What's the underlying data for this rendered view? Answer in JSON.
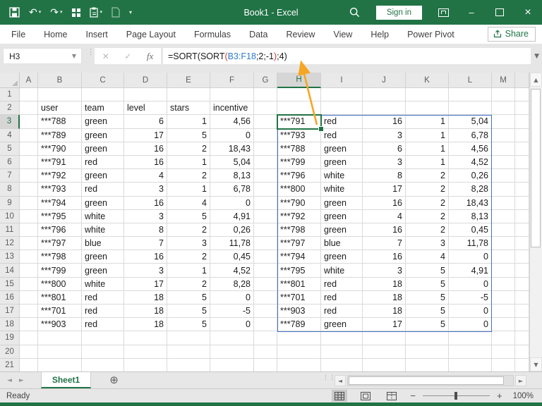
{
  "title_bar": {
    "title": "Book1 - Excel",
    "sign_in_label": "Sign in"
  },
  "ribbon": {
    "tabs": [
      "File",
      "Home",
      "Insert",
      "Page Layout",
      "Formulas",
      "Data",
      "Review",
      "View",
      "Help",
      "Power Pivot"
    ],
    "share_label": "Share"
  },
  "formula_bar": {
    "name_box_value": "H3",
    "fx_label": "fx",
    "formula_text": "=SORT(SORT(B3:F18;2;-1);4)",
    "formula_parts": [
      {
        "text": "=SORT(SORT",
        "color": "#1a1a1a"
      },
      {
        "text": "(",
        "color": "#d23430"
      },
      {
        "text": "B3:F18",
        "color": "#2e7bcf"
      },
      {
        "text": ";2;-1",
        "color": "#1a1a1a"
      },
      {
        "text": ")",
        "color": "#d23430"
      },
      {
        "text": ";4)",
        "color": "#1a1a1a"
      }
    ]
  },
  "grid": {
    "column_letters": [
      "A",
      "B",
      "C",
      "D",
      "E",
      "F",
      "G",
      "H",
      "I",
      "J",
      "K",
      "L",
      "M"
    ],
    "visible_row_count": 21,
    "selected_cell": "H3",
    "spill_range": "H3:L18",
    "source_table": {
      "start_cell": "B2",
      "headers": [
        "user",
        "team",
        "level",
        "stars",
        "incentive"
      ],
      "rows": [
        [
          "***788",
          "green",
          "6",
          "1",
          "4,56"
        ],
        [
          "***789",
          "green",
          "17",
          "5",
          "0"
        ],
        [
          "***790",
          "green",
          "16",
          "2",
          "18,43"
        ],
        [
          "***791",
          "red",
          "16",
          "1",
          "5,04"
        ],
        [
          "***792",
          "green",
          "4",
          "2",
          "8,13"
        ],
        [
          "***793",
          "red",
          "3",
          "1",
          "6,78"
        ],
        [
          "***794",
          "green",
          "16",
          "4",
          "0"
        ],
        [
          "***795",
          "white",
          "3",
          "5",
          "4,91"
        ],
        [
          "***796",
          "white",
          "8",
          "2",
          "0,26"
        ],
        [
          "***797",
          "blue",
          "7",
          "3",
          "11,78"
        ],
        [
          "***798",
          "green",
          "16",
          "2",
          "0,45"
        ],
        [
          "***799",
          "green",
          "3",
          "1",
          "4,52"
        ],
        [
          "***800",
          "white",
          "17",
          "2",
          "8,28"
        ],
        [
          "***801",
          "red",
          "18",
          "5",
          "0"
        ],
        [
          "***701",
          "red",
          "18",
          "5",
          "-5"
        ],
        [
          "***903",
          "red",
          "18",
          "5",
          "0"
        ]
      ]
    },
    "result_table": {
      "start_cell": "H3",
      "rows": [
        [
          "***791",
          "red",
          "16",
          "1",
          "5,04"
        ],
        [
          "***793",
          "red",
          "3",
          "1",
          "6,78"
        ],
        [
          "***788",
          "green",
          "6",
          "1",
          "4,56"
        ],
        [
          "***799",
          "green",
          "3",
          "1",
          "4,52"
        ],
        [
          "***796",
          "white",
          "8",
          "2",
          "0,26"
        ],
        [
          "***800",
          "white",
          "17",
          "2",
          "8,28"
        ],
        [
          "***790",
          "green",
          "16",
          "2",
          "18,43"
        ],
        [
          "***792",
          "green",
          "4",
          "2",
          "8,13"
        ],
        [
          "***798",
          "green",
          "16",
          "2",
          "0,45"
        ],
        [
          "***797",
          "blue",
          "7",
          "3",
          "11,78"
        ],
        [
          "***794",
          "green",
          "16",
          "4",
          "0"
        ],
        [
          "***795",
          "white",
          "3",
          "5",
          "4,91"
        ],
        [
          "***801",
          "red",
          "18",
          "5",
          "0"
        ],
        [
          "***701",
          "red",
          "18",
          "5",
          "-5"
        ],
        [
          "***903",
          "red",
          "18",
          "5",
          "0"
        ],
        [
          "***789",
          "green",
          "17",
          "5",
          "0"
        ]
      ]
    }
  },
  "annotation": {
    "arrow_from": "H3",
    "arrow_to": "formula_bar",
    "color": "#f5a623"
  },
  "sheet_bar": {
    "tabs": [
      {
        "label": "Sheet1",
        "active": true
      }
    ]
  },
  "status_bar": {
    "status": "Ready",
    "zoom_level": "100%"
  },
  "colors": {
    "excel_green": "#217346",
    "spill_border": "#4472c4",
    "selection": "#217346",
    "arrow": "#f5a623"
  }
}
